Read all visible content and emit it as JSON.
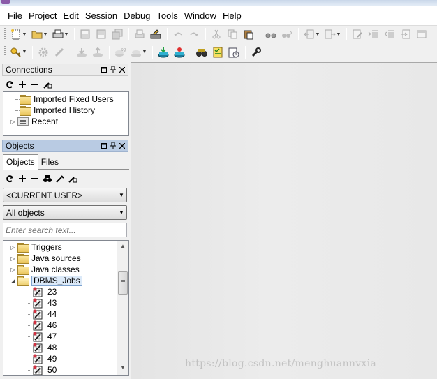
{
  "menubar": {
    "items": [
      {
        "label": "File",
        "mnemonic": "F",
        "rest": "ile"
      },
      {
        "label": "Project",
        "mnemonic": "P",
        "rest": "roject"
      },
      {
        "label": "Edit",
        "mnemonic": "E",
        "rest": "dit"
      },
      {
        "label": "Session",
        "mnemonic": "S",
        "rest": "ession"
      },
      {
        "label": "Debug",
        "mnemonic": "D",
        "rest": "ebug"
      },
      {
        "label": "Tools",
        "mnemonic": "T",
        "rest": "ools"
      },
      {
        "label": "Window",
        "mnemonic": "W",
        "rest": "indow"
      },
      {
        "label": "Help",
        "mnemonic": "H",
        "rest": "elp"
      }
    ]
  },
  "connections_panel": {
    "title": "Connections",
    "tree": [
      {
        "label": "Imported Fixed Users",
        "icon": "folder-icon"
      },
      {
        "label": "Imported History",
        "icon": "folder-icon"
      },
      {
        "label": "Recent",
        "icon": "recent-connections-icon"
      }
    ]
  },
  "objects_panel": {
    "title": "Objects",
    "tabs": [
      {
        "label": "Objects",
        "active": true
      },
      {
        "label": "Files",
        "active": false
      }
    ],
    "user_combo": "<CURRENT USER>",
    "filter_combo": "All objects",
    "search_placeholder": "Enter search text...",
    "tree": [
      {
        "label": "Triggers",
        "icon": "folder-icon"
      },
      {
        "label": "Java sources",
        "icon": "folder-icon"
      },
      {
        "label": "Java classes",
        "icon": "folder-icon"
      },
      {
        "label": "DBMS_Jobs",
        "icon": "folder-open-icon",
        "selected": true
      }
    ],
    "jobs": [
      "23",
      "43",
      "44",
      "46",
      "47",
      "48",
      "49",
      "50"
    ]
  },
  "colors": {
    "objects_header": "#b9cbe3",
    "main_area": "#e8e8e8",
    "folder": "#e9c45a"
  },
  "watermark": "https://blog.csdn.net/menghuannvxia"
}
